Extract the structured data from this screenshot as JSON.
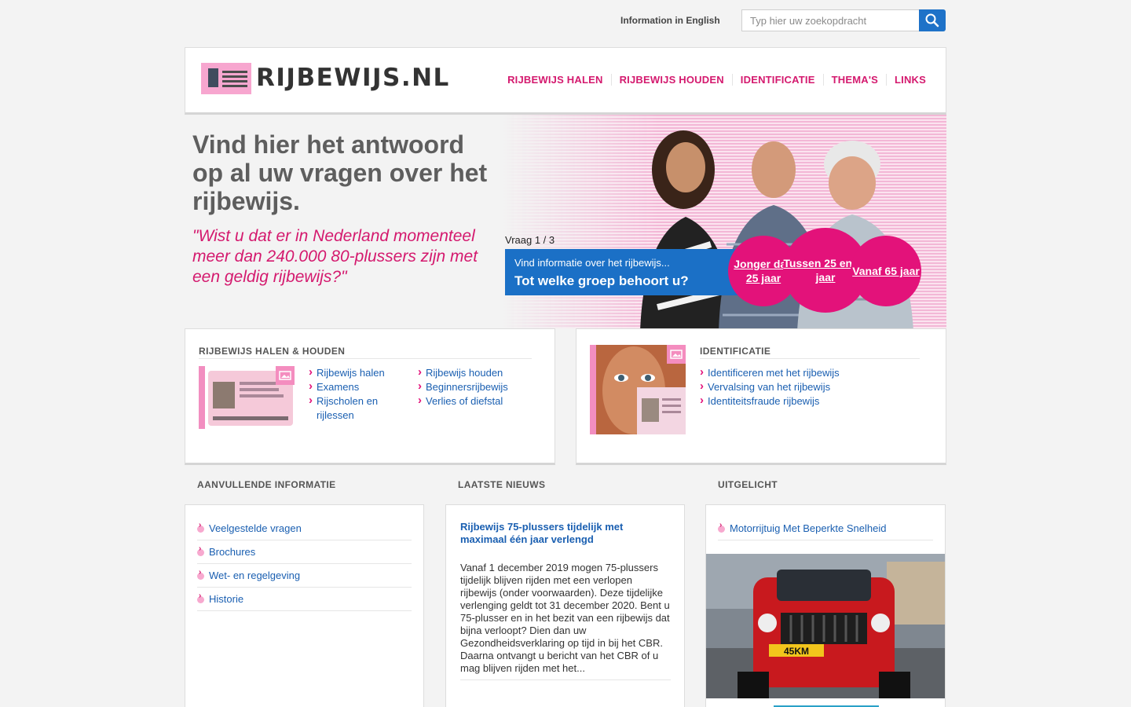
{
  "topbar": {
    "english_link": "Information in English",
    "search_placeholder": "Typ hier uw zoekopdracht"
  },
  "header": {
    "logo_text": "RIJBEWIJS.NL",
    "nav": [
      "RIJBEWIJS HALEN",
      "RIJBEWIJS HOUDEN",
      "IDENTIFICATIE",
      "THEMA'S",
      "LINKS"
    ]
  },
  "hero": {
    "title": "Vind hier het antwoord op al uw vragen over het rijbewijs.",
    "quote": "\"Wist u dat er in Nederland momenteel meer dan 240.000 80-plussers zijn met een geldig rijbewijs?\"",
    "question_counter": "Vraag 1 / 3",
    "question_sub": "Vind informatie over het rijbewijs...",
    "question_main": "Tot welke groep behoort u?",
    "answers": [
      "Jonger dan 25 jaar",
      "Tussen 25 en 64 jaar",
      "Vanaf 65 jaar"
    ]
  },
  "panel_halen": {
    "title": "RIJBEWIJS HALEN & HOUDEN",
    "links_col1": [
      "Rijbewijs halen",
      "Examens",
      "Rijscholen en rijlessen"
    ],
    "links_col2": [
      "Rijbewijs houden",
      "Beginnersrijbewijs",
      "Verlies of diefstal"
    ]
  },
  "panel_identificatie": {
    "title": "IDENTIFICATIE",
    "links": [
      "Identificeren met het rijbewijs",
      "Vervalsing van het rijbewijs",
      "Identiteitsfraude rijbewijs"
    ]
  },
  "aanvullend": {
    "heading": "AANVULLENDE INFORMATIE",
    "links": [
      "Veelgestelde vragen",
      "Brochures",
      "Wet- en regelgeving",
      "Historie"
    ]
  },
  "nieuws": {
    "heading": "LAATSTE NIEUWS",
    "title": "Rijbewijs 75-plussers tijdelijk met maximaal één jaar verlengd",
    "body": "Vanaf 1 december 2019 mogen 75-plussers tijdelijk blijven rijden met een verlopen rijbewijs (onder voorwaarden). Deze tijdelijke verlenging geldt tot 31 december 2020. Bent u 75-plusser en in het bezit van een rijbewijs dat bijna verloopt? Dien dan uw Gezondheidsverklaring op tijd in bij het CBR. Daarna ontvangt u bericht van het CBR of u mag blijven rijden met het..."
  },
  "uitgelicht": {
    "heading": "UITGELICHT",
    "link": "Motorrijtuig Met Beperkte Snelheid",
    "plate": "45KM"
  },
  "colors": {
    "brand_pink": "#d4196e",
    "circle_pink": "#e3127a",
    "brand_blue": "#1b70c6",
    "link_blue": "#1a5fb1"
  }
}
